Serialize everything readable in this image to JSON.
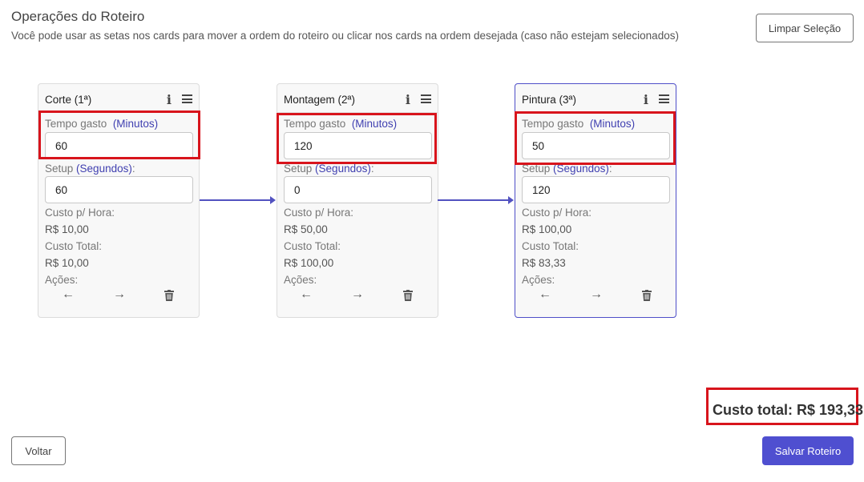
{
  "page": {
    "title": "Operações do Roteiro",
    "subtitle": "Você pode usar as setas nos cards para mover a ordem do roteiro ou clicar nos cards na ordem desejada (caso não estejam selecionados)"
  },
  "buttons": {
    "clear": "Limpar Seleção",
    "back": "Voltar",
    "save": "Salvar Roteiro"
  },
  "labels": {
    "tempo_prefix": "Tempo gasto",
    "tempo_unit": "(Minutos)",
    "setup_prefix": "Setup",
    "setup_unit": "(Segundos)",
    "setup_suffix": ":",
    "custo_hora": "Custo p/ Hora:",
    "custo_total": "Custo Total:",
    "acoes": "Ações:"
  },
  "cards": [
    {
      "title": "Corte (1ª)",
      "tempo": "60",
      "setup": "60",
      "custo_hora": "R$ 10,00",
      "custo_total": "R$ 10,00",
      "selected": false
    },
    {
      "title": "Montagem (2ª)",
      "tempo": "120",
      "setup": "0",
      "custo_hora": "R$ 50,00",
      "custo_total": "R$ 100,00",
      "selected": false
    },
    {
      "title": "Pintura (3ª)",
      "tempo": "50",
      "setup": "120",
      "custo_hora": "R$ 100,00",
      "custo_total": "R$ 83,33",
      "selected": true
    }
  ],
  "icons": {
    "info": "info-icon",
    "menu": "menu-icon",
    "left": "arrow-left-icon",
    "right": "arrow-right-icon",
    "delete": "trash-icon"
  },
  "summary": {
    "total_label": "Custo total: R$ 193,33"
  },
  "colors": {
    "accent": "#4f4fd0",
    "highlight": "#d8141c",
    "connector": "#5252c0"
  }
}
